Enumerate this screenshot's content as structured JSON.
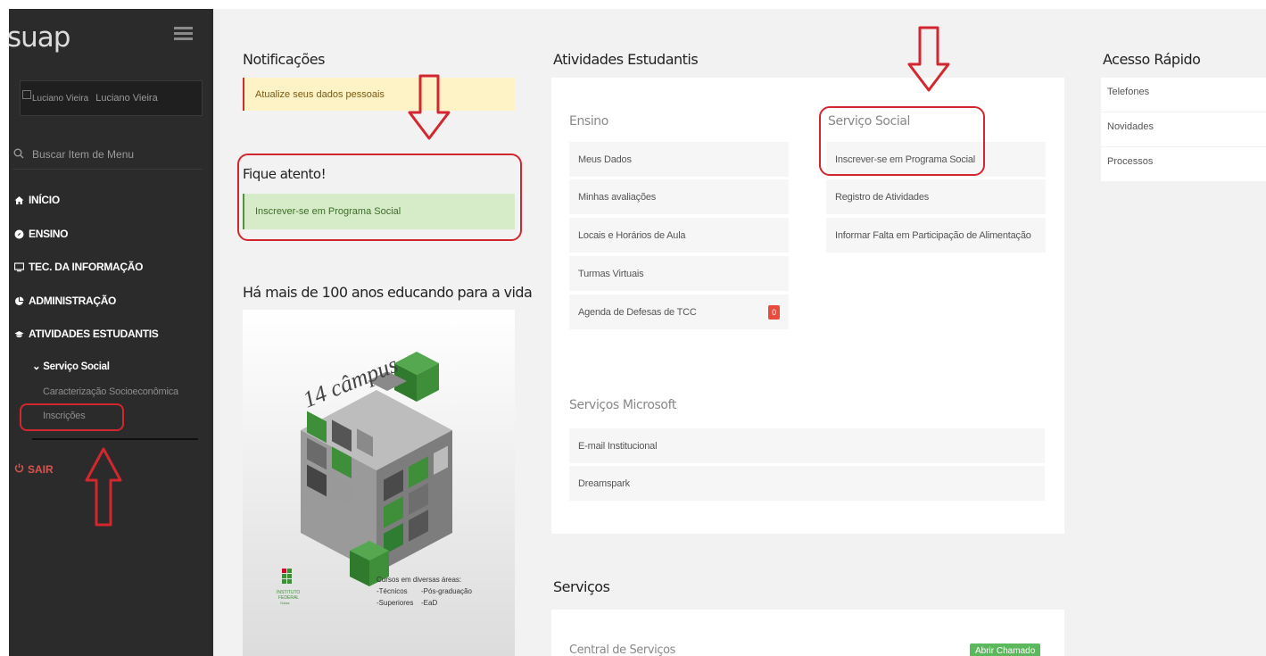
{
  "sidebar": {
    "logo": "suap",
    "user": {
      "image_alt": "Luciano Vieira",
      "name": "Luciano Vieira"
    },
    "search_label": "Buscar Item de Menu",
    "menu": [
      {
        "label": "INÍCIO",
        "icon": "home-icon"
      },
      {
        "label": "ENSINO",
        "icon": "compass-icon"
      },
      {
        "label": "TEC. DA INFORMAÇÃO",
        "icon": "monitor-icon"
      },
      {
        "label": "ADMINISTRAÇÃO",
        "icon": "pie-chart-icon"
      },
      {
        "label": "ATIVIDADES ESTUDANTIS",
        "icon": "graduation-cap-icon"
      }
    ],
    "submenu_title": "Serviço Social",
    "submenu_items": [
      "Caracterização Socioeconômica",
      "Inscrições"
    ],
    "logout": "SAIR"
  },
  "notifications": {
    "title": "Notificações",
    "alert": "Atualize seus dados pessoais",
    "attention_title": "Fique atento!",
    "attention_item": "Inscrever-se em Programa Social"
  },
  "promo": {
    "title": "Há mais de 100 anos educando para a vida",
    "campus": "14 câmpus",
    "institute_lines": [
      "INSTITUTO",
      "FEDERAL",
      "Goiás"
    ],
    "courses_heading": "Cursos em diversas áreas:",
    "courses": [
      "-Técnicos",
      "-Pós-graduação",
      "-Superiores",
      "-EaD"
    ]
  },
  "student_activities": {
    "title": "Atividades Estudantis",
    "ensino": {
      "title": "Ensino",
      "items": [
        "Meus Dados",
        "Minhas avaliações",
        "Locais e Horários de Aula",
        "Turmas Virtuais",
        "Agenda de Defesas de TCC"
      ],
      "badge": "0"
    },
    "social": {
      "title": "Serviço Social",
      "items": [
        "Inscrever-se em Programa Social",
        "Registro de Atividades",
        "Informar Falta em Participação de Alimentação"
      ]
    },
    "microsoft": {
      "title": "Serviços Microsoft",
      "items": [
        "E-mail Institucional",
        "Dreamspark"
      ]
    }
  },
  "services": {
    "title": "Serviços",
    "central": "Central de Serviços",
    "button": "Abrir Chamado"
  },
  "quick_access": {
    "title": "Acesso Rápido",
    "items": [
      "Telefones",
      "Novidades",
      "Processos"
    ]
  },
  "colors": {
    "sidebar_bg": "#2b2b2b",
    "annotation_red": "#d3272f",
    "green": "#5cb85c",
    "alert_bg": "#fdf3c7",
    "success_bg": "#d6ebc7"
  }
}
